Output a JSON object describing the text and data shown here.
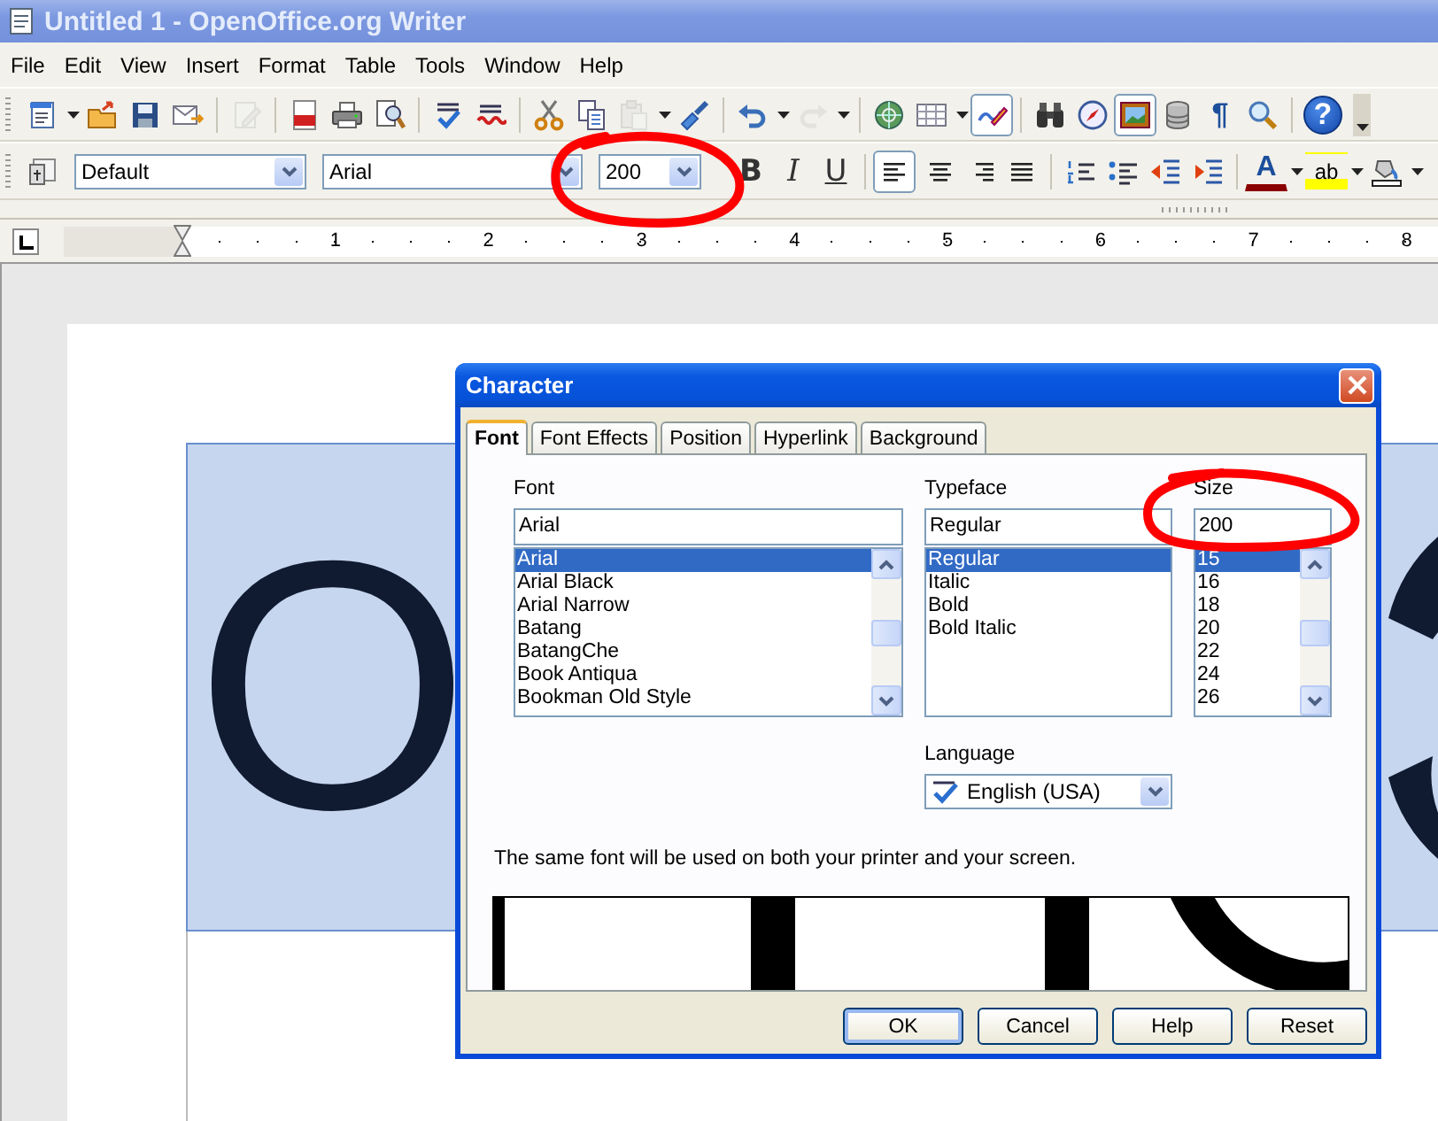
{
  "window": {
    "title": "Untitled 1 - OpenOffice.org Writer"
  },
  "menu": [
    "File",
    "Edit",
    "View",
    "Insert",
    "Format",
    "Table",
    "Tools",
    "Window",
    "Help"
  ],
  "standard_toolbar": {
    "edit_disabled": true,
    "paste_disabled": true,
    "redo_disabled": true,
    "draw_functions_on": true,
    "gallery_on": true,
    "pilcrow_glyph": "¶",
    "help_glyph": "?"
  },
  "formatting_toolbar": {
    "paragraph_style": "Default",
    "font_name": "Arial",
    "font_size": "200",
    "font_size_circled": true,
    "text_styles": [
      {
        "kind": "bold",
        "label": "B"
      },
      {
        "kind": "italic",
        "label": "I"
      },
      {
        "kind": "underline",
        "label": "U"
      }
    ],
    "alignment": [
      {
        "kind": "left",
        "selected": true
      },
      {
        "kind": "center",
        "selected": false
      },
      {
        "kind": "right",
        "selected": false
      },
      {
        "kind": "justify",
        "selected": false
      }
    ],
    "font_color_letter": "A",
    "highlight_letters": "ab"
  },
  "ruler": {
    "numbers": [
      "1",
      "2",
      "3",
      "4",
      "5",
      "6",
      "7",
      "8"
    ]
  },
  "document": {
    "text": "O",
    "selected": true
  },
  "dialog": {
    "title": "Character",
    "tabs": [
      {
        "label": "Font",
        "selected": true
      },
      {
        "label": "Font Effects",
        "selected": false
      },
      {
        "label": "Position",
        "selected": false
      },
      {
        "label": "Hyperlink",
        "selected": false
      },
      {
        "label": "Background",
        "selected": false
      }
    ],
    "font": {
      "label": "Font",
      "value": "Arial",
      "items": [
        {
          "label": "Arial",
          "selected": true
        },
        {
          "label": "Arial Black",
          "selected": false
        },
        {
          "label": "Arial Narrow",
          "selected": false
        },
        {
          "label": "Batang",
          "selected": false
        },
        {
          "label": "BatangChe",
          "selected": false
        },
        {
          "label": "Book Antiqua",
          "selected": false
        },
        {
          "label": "Bookman Old Style",
          "selected": false
        }
      ]
    },
    "typeface": {
      "label": "Typeface",
      "value": "Regular",
      "items": [
        {
          "label": "Regular",
          "selected": true
        },
        {
          "label": "Italic",
          "selected": false
        },
        {
          "label": "Bold",
          "selected": false
        },
        {
          "label": "Bold Italic",
          "selected": false
        }
      ]
    },
    "size": {
      "label": "Size",
      "value": "200",
      "circled": true,
      "items": [
        {
          "label": "15",
          "selected": true
        },
        {
          "label": "16",
          "selected": false
        },
        {
          "label": "18",
          "selected": false
        },
        {
          "label": "20",
          "selected": false
        },
        {
          "label": "22",
          "selected": false
        },
        {
          "label": "24",
          "selected": false
        },
        {
          "label": "26",
          "selected": false
        }
      ]
    },
    "language": {
      "label": "Language",
      "value": "English (USA)"
    },
    "note": "The same font will be used on both your printer and your screen.",
    "buttons": [
      {
        "label": "OK",
        "default": true
      },
      {
        "label": "Cancel",
        "default": false
      },
      {
        "label": "Help",
        "default": false
      },
      {
        "label": "Reset",
        "default": false
      }
    ]
  }
}
